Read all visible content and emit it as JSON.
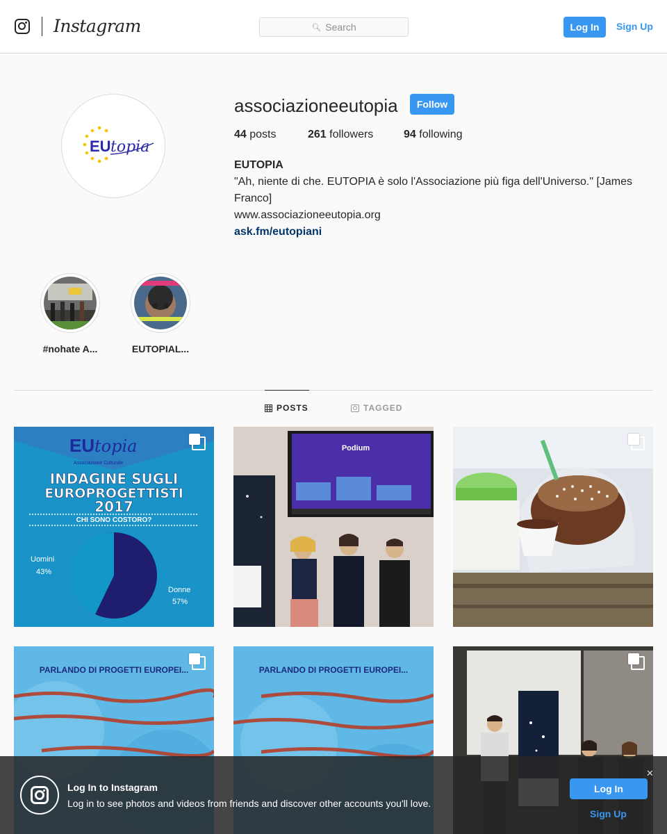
{
  "header": {
    "wordmark": "Instagram",
    "search_placeholder": "Search",
    "login_label": "Log In",
    "signup_label": "Sign Up"
  },
  "profile": {
    "username": "associazioneeutopia",
    "follow_label": "Follow",
    "posts_count": "44",
    "posts_label": "posts",
    "followers_count": "261",
    "followers_label": "followers",
    "following_count": "94",
    "following_label": "following",
    "full_name": "EUTOPIA",
    "bio_text": "\"Ah, niente di che. EUTOPIA è solo l'Associazione più figa dell'Universo.\" [James Franco]",
    "website": "www.associazioneeutopia.org",
    "link": "ask.fm/eutopiani",
    "avatar_text_eu": "EU",
    "avatar_text_topia": "topia"
  },
  "highlights": [
    {
      "label": "#nohate A..."
    },
    {
      "label": "EUTOPIAL..."
    }
  ],
  "tabs": {
    "posts": "POSTS",
    "tagged": "TAGGED"
  },
  "posts": [
    {
      "brand_eu": "EU",
      "brand_topia": "topia",
      "brand_sub": "Associazione Culturale",
      "headline1": "INDAGINE SUGLI",
      "headline2": "EUROPROGETTISTI",
      "headline3": "2017",
      "question": "CHI SONO COSTORO?",
      "slice1_label": "Uomini",
      "slice1_value": "43%",
      "slice2_label": "Donne",
      "slice2_value": "57%"
    },
    {
      "screen_title": "Podium"
    },
    {},
    {
      "header": "PARLANDO DI PROGETTI EUROPEI..."
    },
    {
      "header": "PARLANDO DI PROGETTI EUROPEI..."
    },
    {}
  ],
  "banner": {
    "title": "Log In to Instagram",
    "description": "Log in to see photos and videos from friends and discover other accounts you'll love.",
    "login_label": "Log In",
    "signup_label": "Sign Up",
    "close_glyph": "✕"
  },
  "colors": {
    "accent": "#3897f0",
    "link": "#003569"
  }
}
